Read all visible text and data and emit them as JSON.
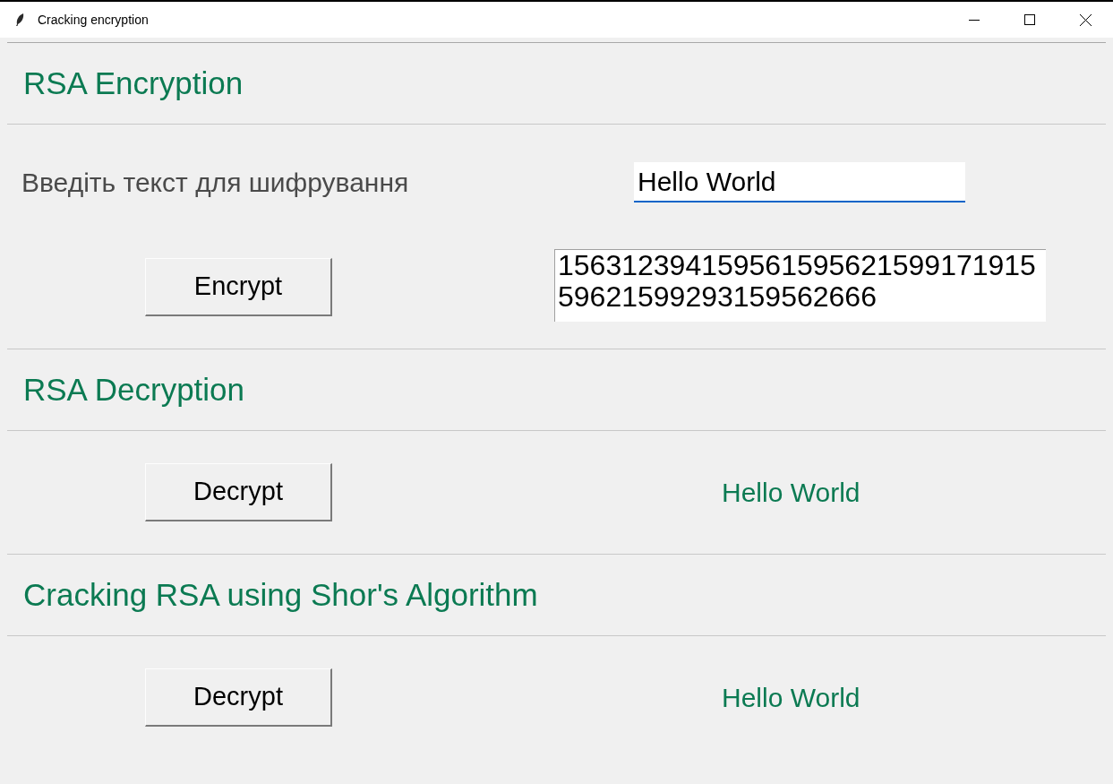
{
  "window": {
    "title": "Cracking encryption"
  },
  "sections": [
    {
      "kind": "encrypt",
      "heading": "RSA Encryption",
      "prompt": "Введіть текст для шифрування",
      "input_value": "Hello World",
      "button": "Encrypt",
      "output": "15631239415956159562159917191559621599293159562666"
    },
    {
      "kind": "decrypt",
      "heading": "RSA Decryption",
      "button": "Decrypt",
      "result": "Hello World"
    },
    {
      "kind": "decrypt",
      "heading": "Cracking RSA using Shor's Algorithm",
      "button": "Decrypt",
      "result": "Hello World"
    }
  ]
}
